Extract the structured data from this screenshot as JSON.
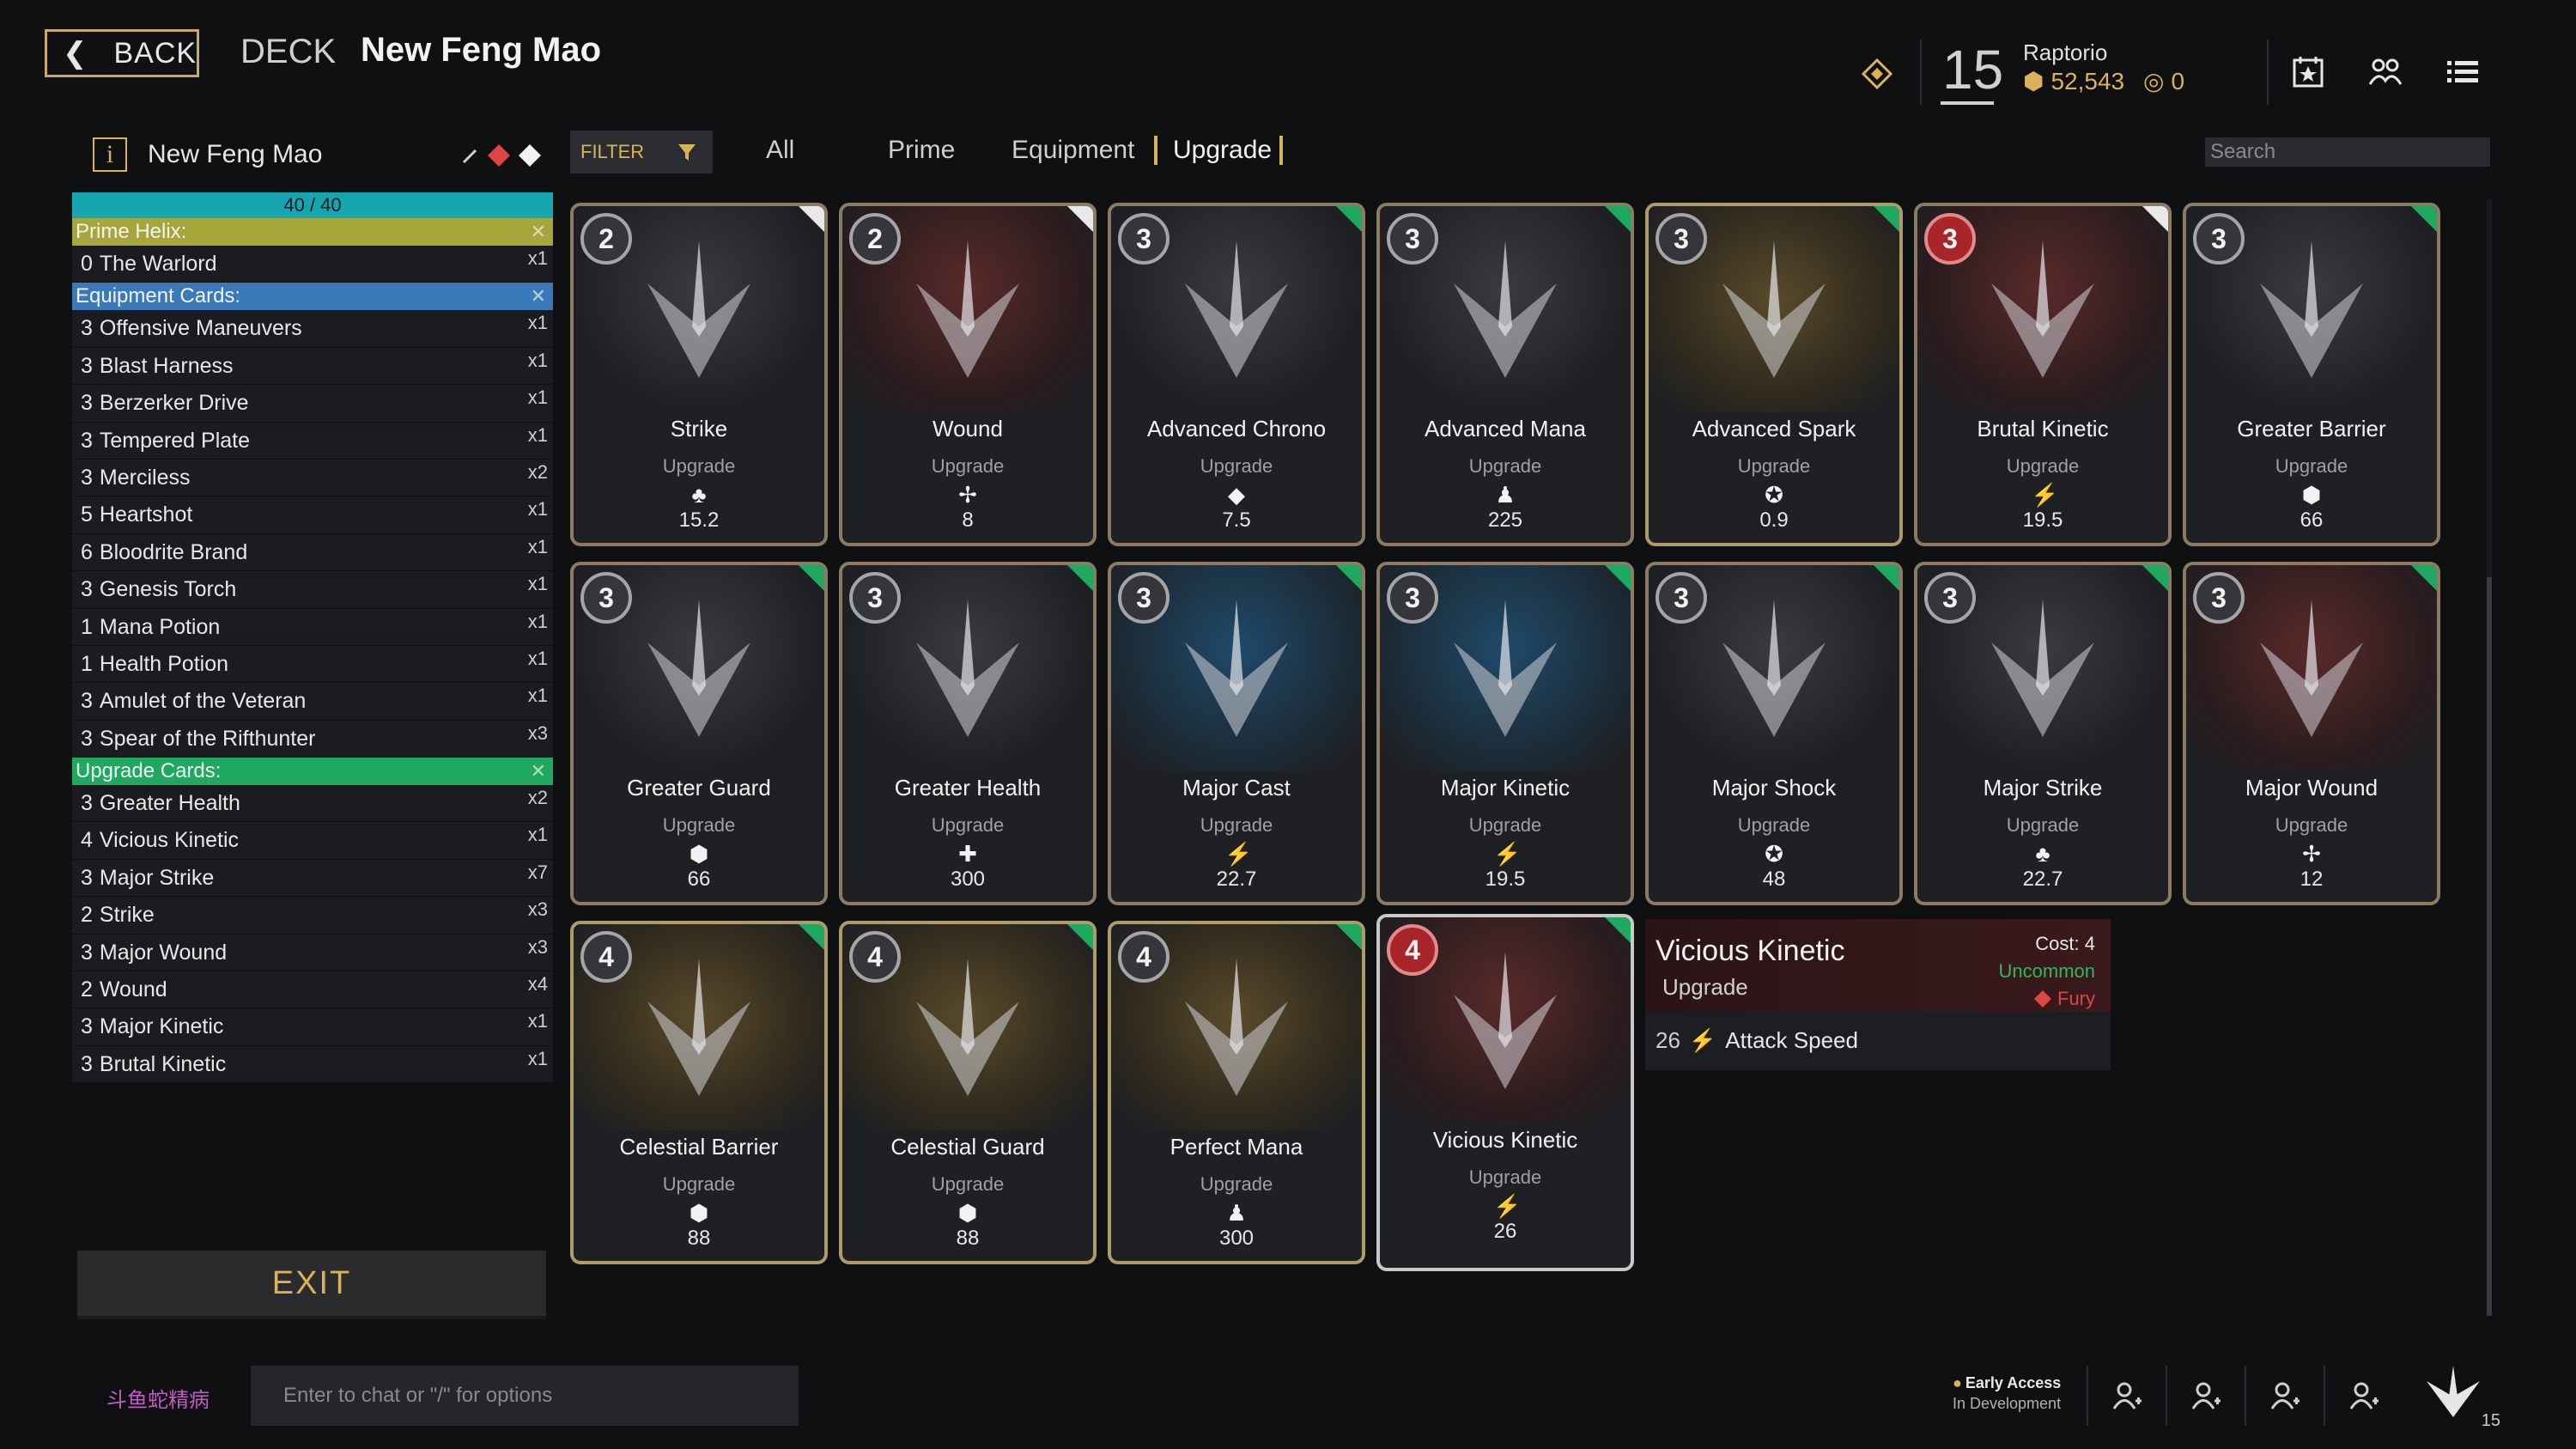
{
  "header": {
    "back_label": "BACK",
    "section": "DECK",
    "title": "New Feng Mao"
  },
  "player": {
    "level": "15",
    "name": "Raptorio",
    "gold": "52,543",
    "other": "0"
  },
  "sidebar": {
    "deck_name": "New Feng Mao",
    "count": "40 / 40",
    "prime_header": "Prime Helix:",
    "prime": [
      {
        "cost": "0",
        "name": "The Warlord",
        "qty": "x1"
      }
    ],
    "equipment_header": "Equipment Cards:",
    "equipment": [
      {
        "cost": "3",
        "name": "Offensive Maneuvers",
        "qty": "x1"
      },
      {
        "cost": "3",
        "name": "Blast Harness",
        "qty": "x1"
      },
      {
        "cost": "3",
        "name": "Berzerker Drive",
        "qty": "x1"
      },
      {
        "cost": "3",
        "name": "Tempered Plate",
        "qty": "x1"
      },
      {
        "cost": "3",
        "name": "Merciless",
        "qty": "x2"
      },
      {
        "cost": "5",
        "name": "Heartshot",
        "qty": "x1"
      },
      {
        "cost": "6",
        "name": "Bloodrite Brand",
        "qty": "x1"
      },
      {
        "cost": "3",
        "name": "Genesis Torch",
        "qty": "x1"
      },
      {
        "cost": "1",
        "name": "Mana Potion",
        "qty": "x1"
      },
      {
        "cost": "1",
        "name": "Health Potion",
        "qty": "x1"
      },
      {
        "cost": "3",
        "name": "Amulet of the Veteran",
        "qty": "x1"
      },
      {
        "cost": "3",
        "name": "Spear of the Rifthunter",
        "qty": "x3"
      }
    ],
    "upgrade_header": "Upgrade Cards:",
    "upgrades": [
      {
        "cost": "3",
        "name": "Greater Health",
        "qty": "x2"
      },
      {
        "cost": "4",
        "name": "Vicious Kinetic",
        "qty": "x1"
      },
      {
        "cost": "3",
        "name": "Major Strike",
        "qty": "x7"
      },
      {
        "cost": "2",
        "name": "Strike",
        "qty": "x3"
      },
      {
        "cost": "3",
        "name": "Major Wound",
        "qty": "x3"
      },
      {
        "cost": "2",
        "name": "Wound",
        "qty": "x4"
      },
      {
        "cost": "3",
        "name": "Major Kinetic",
        "qty": "x1"
      },
      {
        "cost": "3",
        "name": "Brutal Kinetic",
        "qty": "x1"
      }
    ],
    "exit_label": "EXIT"
  },
  "filter": {
    "label": "FILTER",
    "tabs": [
      "All",
      "Prime",
      "Equipment",
      "Upgrade"
    ],
    "search_placeholder": "Search"
  },
  "cards": [
    {
      "cost": "2",
      "name": "Strike",
      "type": "Upgrade",
      "icon": "club-icon",
      "glyph": "♣",
      "value": "15.2",
      "corner": "white",
      "theme": "dark"
    },
    {
      "cost": "2",
      "name": "Wound",
      "type": "Upgrade",
      "icon": "wound-icon",
      "glyph": "✢",
      "value": "8",
      "corner": "white",
      "theme": "red"
    },
    {
      "cost": "3",
      "name": "Advanced Chrono",
      "type": "Upgrade",
      "icon": "chrono-icon",
      "glyph": "◆",
      "value": "7.5",
      "corner": "green",
      "theme": "dark"
    },
    {
      "cost": "3",
      "name": "Advanced Mana",
      "type": "Upgrade",
      "icon": "mana-icon",
      "glyph": "♟",
      "value": "225",
      "corner": "green",
      "theme": "dark"
    },
    {
      "cost": "3",
      "name": "Advanced Spark",
      "type": "Upgrade",
      "icon": "spark-icon",
      "glyph": "✪",
      "value": "0.9",
      "corner": "green",
      "theme": "gold"
    },
    {
      "cost": "3",
      "name": "Brutal Kinetic",
      "type": "Upgrade",
      "icon": "kinetic-icon",
      "glyph": "⚡",
      "value": "19.5",
      "corner": "white",
      "theme": "red",
      "badge": "red"
    },
    {
      "cost": "3",
      "name": "Greater Barrier",
      "type": "Upgrade",
      "icon": "barrier-icon",
      "glyph": "⬢",
      "value": "66",
      "corner": "green",
      "theme": "dark"
    },
    {
      "cost": "3",
      "name": "Greater Guard",
      "type": "Upgrade",
      "icon": "guard-icon",
      "glyph": "⬢",
      "value": "66",
      "corner": "green",
      "theme": "dark"
    },
    {
      "cost": "3",
      "name": "Greater Health",
      "type": "Upgrade",
      "icon": "health-icon",
      "glyph": "✚",
      "value": "300",
      "corner": "green",
      "theme": "dark"
    },
    {
      "cost": "3",
      "name": "Major Cast",
      "type": "Upgrade",
      "icon": "cast-icon",
      "glyph": "⚡",
      "value": "22.7",
      "corner": "green",
      "theme": "blue"
    },
    {
      "cost": "3",
      "name": "Major Kinetic",
      "type": "Upgrade",
      "icon": "kinetic-icon",
      "glyph": "⚡",
      "value": "19.5",
      "corner": "green",
      "theme": "blue"
    },
    {
      "cost": "3",
      "name": "Major Shock",
      "type": "Upgrade",
      "icon": "shock-icon",
      "glyph": "✪",
      "value": "48",
      "corner": "green",
      "theme": "dark"
    },
    {
      "cost": "3",
      "name": "Major Strike",
      "type": "Upgrade",
      "icon": "club-icon",
      "glyph": "♣",
      "value": "22.7",
      "corner": "green",
      "theme": "dark"
    },
    {
      "cost": "3",
      "name": "Major Wound",
      "type": "Upgrade",
      "icon": "wound-icon",
      "glyph": "✢",
      "value": "12",
      "corner": "green",
      "theme": "red"
    },
    {
      "cost": "4",
      "name": "Celestial Barrier",
      "type": "Upgrade",
      "icon": "barrier-icon",
      "glyph": "⬢",
      "value": "88",
      "corner": "green",
      "theme": "gold"
    },
    {
      "cost": "4",
      "name": "Celestial Guard",
      "type": "Upgrade",
      "icon": "guard-icon",
      "glyph": "⬢",
      "value": "88",
      "corner": "green",
      "theme": "gold"
    },
    {
      "cost": "4",
      "name": "Perfect Mana",
      "type": "Upgrade",
      "icon": "mana-icon",
      "glyph": "♟",
      "value": "300",
      "corner": "green",
      "theme": "gold"
    },
    {
      "cost": "4",
      "name": "Vicious Kinetic",
      "type": "Upgrade",
      "icon": "kinetic-icon",
      "glyph": "⚡",
      "value": "26",
      "corner": "green",
      "theme": "red",
      "badge": "red",
      "selected": true
    }
  ],
  "tooltip": {
    "name": "Vicious Kinetic",
    "type": "Upgrade",
    "cost": "Cost: 4",
    "rarity": "Uncommon",
    "affinity": "Fury",
    "stat_value": "26",
    "stat_name": "Attack Speed"
  },
  "chat": {
    "brand": "斗鱼蛇精病",
    "placeholder": "Enter to chat or \"/\" for options"
  },
  "footer": {
    "early_access_1": "Early Access",
    "early_access_2": "In Development",
    "party_level": "15"
  },
  "colors": {
    "accent_gold": "#d9b25a",
    "prime": "#a6a63a",
    "equipment": "#3a7ab8",
    "upgrade": "#1fa860",
    "count_bar": "#17a6b0"
  }
}
